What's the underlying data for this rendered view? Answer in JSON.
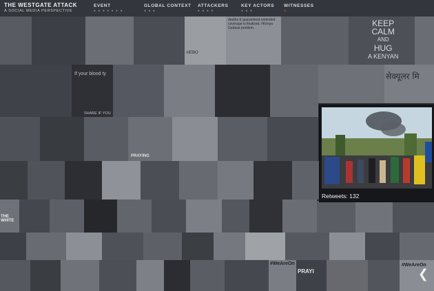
{
  "brand": {
    "title": "THE WESTGATE ATTACK",
    "subtitle": "A SOCIAL MEDIA PERSPECTIVE"
  },
  "nav": {
    "items": [
      {
        "label": "EVENT",
        "dots": "● ● ● ● ● ● ●"
      },
      {
        "label": "GLOBAL CONTEXT",
        "dots": "● ● ●"
      },
      {
        "label": "ATTACKERS",
        "dots": "● ● ● ●"
      },
      {
        "label": "KEY ACTORS",
        "dots": "● ● ●"
      },
      {
        "label": "WITNESSES",
        "dots": "●"
      }
    ]
  },
  "mosaic": {
    "texts": {
      "blood": "If your blood ty",
      "share": "SHARE IF YOU",
      "keep1": "KEEP",
      "keep2": "CALM",
      "keep3": "AND",
      "keep4": "HUG",
      "keep5": "A KENYAN",
      "hindi": "सेक्यूलर मि",
      "hashtag_weare": "#WeAreOn",
      "hashtag_weare2": "#WeAreOn",
      "praying": "PRAYING",
      "praying2": "PRAYI",
      "white_label": "THE WHITE",
      "tweet_snip": "deaths & guaranteed extended coverage is finalized. #Kenya Gedase problem.",
      "iebo": "#IEBO"
    }
  },
  "popup": {
    "caption": "Retweets: 132"
  },
  "controls": {
    "next": "❮"
  }
}
